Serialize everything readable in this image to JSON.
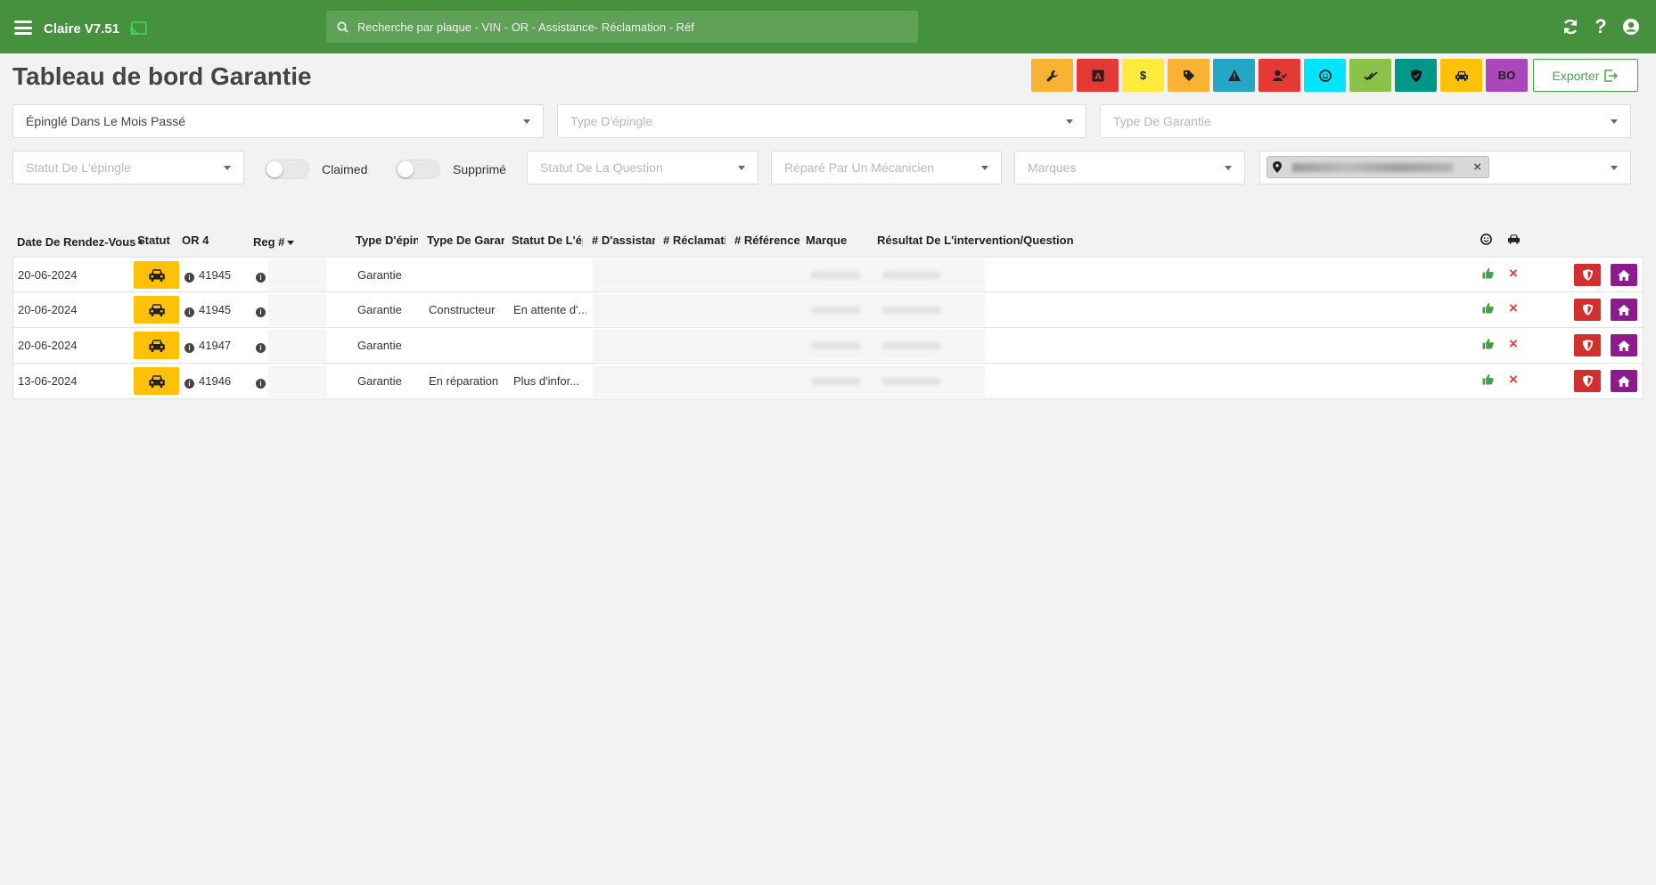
{
  "app": {
    "title": "Claire V7.51",
    "search_placeholder": "Recherche par plaque - VIN - OR - Assistance- Réclamation - Réf"
  },
  "page": {
    "title": "Tableau de bord Garantie",
    "export_label": "Exporter"
  },
  "quick_buttons": [
    {
      "icon": "wrench-icon",
      "color": "#f9b233"
    },
    {
      "icon": "letter-a-icon",
      "color": "#e53935"
    },
    {
      "icon": "dollar-icon",
      "color": "#ffeb3b"
    },
    {
      "icon": "tag-icon",
      "color": "#f9b233"
    },
    {
      "icon": "warning-icon",
      "color": "#26a6c7"
    },
    {
      "icon": "user-check-icon",
      "color": "#e53935"
    },
    {
      "icon": "smiley-icon",
      "color": "#00e5ff"
    },
    {
      "icon": "double-check-icon",
      "color": "#8bc34a"
    },
    {
      "icon": "shield-icon",
      "color": "#009688"
    },
    {
      "icon": "car-icon",
      "color": "#ffc107"
    },
    {
      "icon": "bo-label",
      "label": "BO",
      "color": "#ab47bc"
    }
  ],
  "filters": {
    "pinned_period": "Épinglé Dans Le Mois Passé",
    "pin_type_placeholder": "Type D'épingle",
    "warranty_type_placeholder": "Type De Garantie",
    "pin_status_placeholder": "Statut De L'épingle",
    "claimed_label": "Claimed",
    "deleted_label": "Supprimé",
    "question_status_placeholder": "Statut De La Question",
    "repaired_by_placeholder": "Réparé Par Un Mécanicien",
    "brands_placeholder": "Marques"
  },
  "table": {
    "columns": {
      "date": "Date De Rendez-Vous",
      "status": "Statut",
      "or": "OR",
      "or_count": "4",
      "reg": "Reg #",
      "pin_type": "Type D'épingle",
      "warranty_type": "Type De Garantie",
      "pin_status": "Statut De L'épingle",
      "assistance": "# D'assistance",
      "claim": "# Réclamation",
      "reference": "# Référence",
      "brand": "Marque",
      "result": "Résultat De L'intervention/Question"
    },
    "rows": [
      {
        "date": "20-06-2024",
        "or": "41945",
        "pin_type": "Garantie",
        "warranty_type": "",
        "pin_status": ""
      },
      {
        "date": "20-06-2024",
        "or": "41945",
        "pin_type": "Garantie",
        "warranty_type": "Constructeur",
        "pin_status": "En attente d'..."
      },
      {
        "date": "20-06-2024",
        "or": "41947",
        "pin_type": "Garantie",
        "warranty_type": "",
        "pin_status": ""
      },
      {
        "date": "13-06-2024",
        "or": "41946",
        "pin_type": "Garantie",
        "warranty_type": "En réparation",
        "pin_status": "Plus d'infor..."
      }
    ]
  },
  "colors": {
    "topbar": "#45913d",
    "status_yellow": "#ffc107",
    "action_red": "#d32f2f",
    "action_purple": "#8e1b8e",
    "thumb_green": "#43a047",
    "x_red": "#e53935"
  }
}
